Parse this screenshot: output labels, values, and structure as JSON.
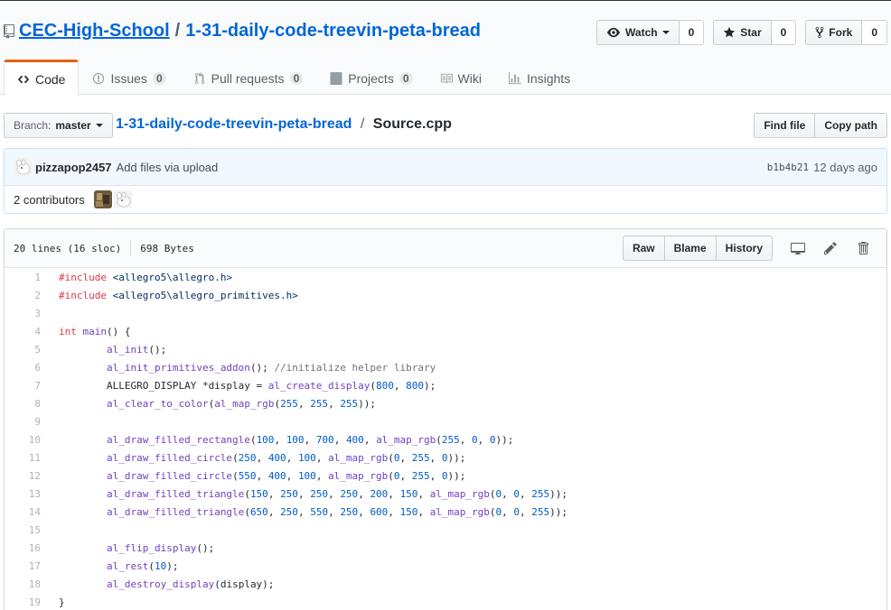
{
  "repo": {
    "owner": "CEC-High-School",
    "separator": "/",
    "name": "1-31-daily-code-treevin-peta-bread"
  },
  "actions": {
    "watch": {
      "label": "Watch",
      "count": "0"
    },
    "star": {
      "label": "Star",
      "count": "0"
    },
    "fork": {
      "label": "Fork",
      "count": "0"
    }
  },
  "nav": [
    {
      "label": "Code",
      "icon": "code-icon"
    },
    {
      "label": "Issues",
      "count": "0",
      "icon": "issue-icon"
    },
    {
      "label": "Pull requests",
      "count": "0",
      "icon": "pull-request-icon"
    },
    {
      "label": "Projects",
      "count": "0",
      "icon": "project-icon"
    },
    {
      "label": "Wiki",
      "icon": "book-icon"
    },
    {
      "label": "Insights",
      "icon": "graph-icon"
    }
  ],
  "file_nav": {
    "branch_label": "Branch:",
    "branch": "master",
    "crumb_repo": "1-31-daily-code-treevin-peta-bread",
    "crumb_sep": "/",
    "crumb_file": "Source.cpp",
    "find_file": "Find file",
    "copy_path": "Copy path"
  },
  "commit": {
    "author": "pizzapop2457",
    "message": "Add files via upload",
    "sha": "b1b4b21",
    "time": "12 days ago"
  },
  "contributors": {
    "label": "2 contributors"
  },
  "file": {
    "lines_info": "20 lines (16 sloc)",
    "size": "698 Bytes",
    "raw": "Raw",
    "blame": "Blame",
    "history": "History"
  },
  "colors": {
    "link": "#0366d6",
    "selected_tab": "#e36209",
    "keyword": "#d73a49",
    "function": "#6f42c1",
    "number": "#005cc5",
    "comment": "#6a737d"
  },
  "code": [
    {
      "n": "1",
      "t": "#include <allegro5\\allegro.h>"
    },
    {
      "n": "2",
      "t": "#include <allegro5\\allegro_primitives.h>"
    },
    {
      "n": "3",
      "t": ""
    },
    {
      "n": "4",
      "t": "int main() {"
    },
    {
      "n": "5",
      "t": "\tal_init();"
    },
    {
      "n": "6",
      "t": "\tal_init_primitives_addon(); //initialize helper library"
    },
    {
      "n": "7",
      "t": "\tALLEGRO_DISPLAY *display = al_create_display(800, 800);"
    },
    {
      "n": "8",
      "t": "\tal_clear_to_color(al_map_rgb(255, 255, 255));"
    },
    {
      "n": "9",
      "t": ""
    },
    {
      "n": "10",
      "t": "\tal_draw_filled_rectangle(100, 100, 700, 400, al_map_rgb(255, 0, 0));"
    },
    {
      "n": "11",
      "t": "\tal_draw_filled_circle(250, 400, 100, al_map_rgb(0, 255, 0));"
    },
    {
      "n": "12",
      "t": "\tal_draw_filled_circle(550, 400, 100, al_map_rgb(0, 255, 0));"
    },
    {
      "n": "13",
      "t": "\tal_draw_filled_triangle(150, 250, 250, 250, 200, 150, al_map_rgb(0, 0, 255));"
    },
    {
      "n": "14",
      "t": "\tal_draw_filled_triangle(650, 250, 550, 250, 600, 150, al_map_rgb(0, 0, 255));"
    },
    {
      "n": "15",
      "t": ""
    },
    {
      "n": "16",
      "t": "\tal_flip_display();"
    },
    {
      "n": "17",
      "t": "\tal_rest(10);"
    },
    {
      "n": "18",
      "t": "\tal_destroy_display(display);"
    },
    {
      "n": "19",
      "t": "}"
    }
  ]
}
